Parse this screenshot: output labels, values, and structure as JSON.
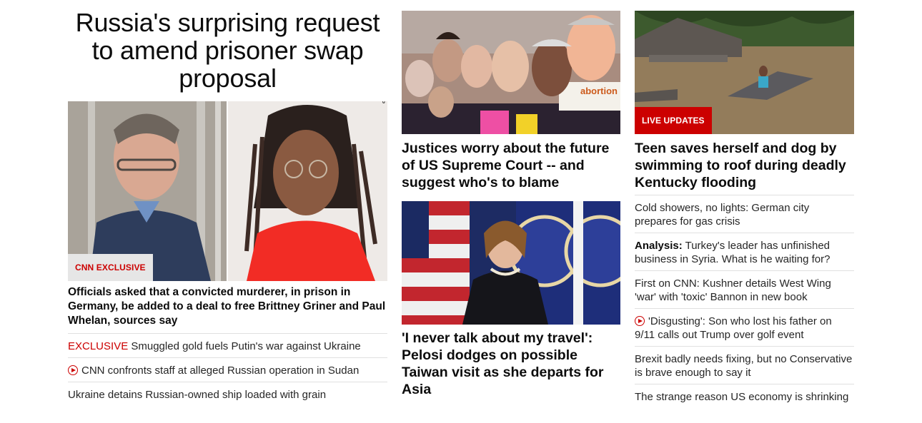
{
  "lead": {
    "title": "Russia's surprising request to amend prisoner swap proposal",
    "badge": "CNN EXCLUSIVE",
    "headline": "Officials asked that a convicted murderer, in prison in Germany, be added to a deal to free Brittney Griner and Paul Whelan, sources say",
    "photo_credit": "AP",
    "links": [
      {
        "kicker": "EXCLUSIVE",
        "text": "Smuggled gold fuels Putin's war against Ukraine",
        "video": false
      },
      {
        "kicker": "",
        "text": "CNN confronts staff at alleged Russian operation in Sudan",
        "video": true
      },
      {
        "kicker": "",
        "text": "Ukraine detains Russian-owned ship loaded with grain",
        "video": false
      }
    ]
  },
  "middle": {
    "story1": {
      "headline": "Justices worry about the future of US Supreme Court -- and suggest who's to blame",
      "sign_text": "abortion"
    },
    "story2": {
      "headline": "'I never talk about my travel': Pelosi dodges on possible Taiwan visit as she departs for Asia"
    }
  },
  "right": {
    "badge": "LIVE UPDATES",
    "headline": "Teen saves herself and dog by swimming to roof during deadly Kentucky flooding",
    "links": [
      {
        "kicker": "",
        "text": "Cold showers, no lights: German city prepares for gas crisis",
        "video": false
      },
      {
        "kicker": "Analysis:",
        "text": "Turkey's leader has unfinished business in Syria. What is he waiting for?",
        "video": false
      },
      {
        "kicker": "",
        "text": "First on CNN: Kushner details West Wing 'war' with 'toxic' Bannon in new book",
        "video": false
      },
      {
        "kicker": "",
        "text": "'Disgusting': Son who lost his father on 9/11 calls out Trump over golf event",
        "video": true
      },
      {
        "kicker": "",
        "text": "Brexit badly needs fixing, but no Conservative is brave enough to say it",
        "video": false
      },
      {
        "kicker": "",
        "text": "The strange reason US economy is shrinking",
        "video": false
      }
    ]
  },
  "colors": {
    "accent": "#cc0000",
    "text": "#0c0c0c",
    "divider": "#e0e0e0"
  }
}
